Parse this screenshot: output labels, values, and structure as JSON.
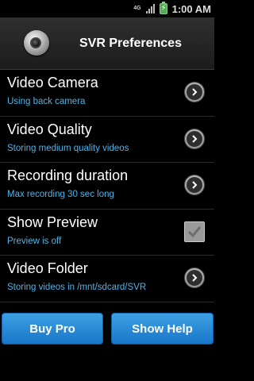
{
  "status_bar": {
    "network_type": "4G",
    "time": "1:00 AM"
  },
  "header": {
    "title": "SVR Preferences"
  },
  "preferences": [
    {
      "title": "Video Camera",
      "summary": "Using back camera",
      "control": "chevron"
    },
    {
      "title": "Video Quality",
      "summary": "Storing medium quality videos",
      "control": "chevron"
    },
    {
      "title": "Recording duration",
      "summary": "Max recording 30 sec long",
      "control": "chevron"
    },
    {
      "title": "Show Preview",
      "summary": "Preview is off",
      "control": "checkbox",
      "checked": true
    },
    {
      "title": "Video Folder",
      "summary": "Storing videos in /mnt/sdcard/SVR",
      "control": "chevron"
    }
  ],
  "buttons": {
    "buy_pro": "Buy Pro",
    "show_help": "Show Help"
  },
  "colors": {
    "summary_text": "#4fb3e8",
    "button_blue": "#2a8ad6"
  }
}
